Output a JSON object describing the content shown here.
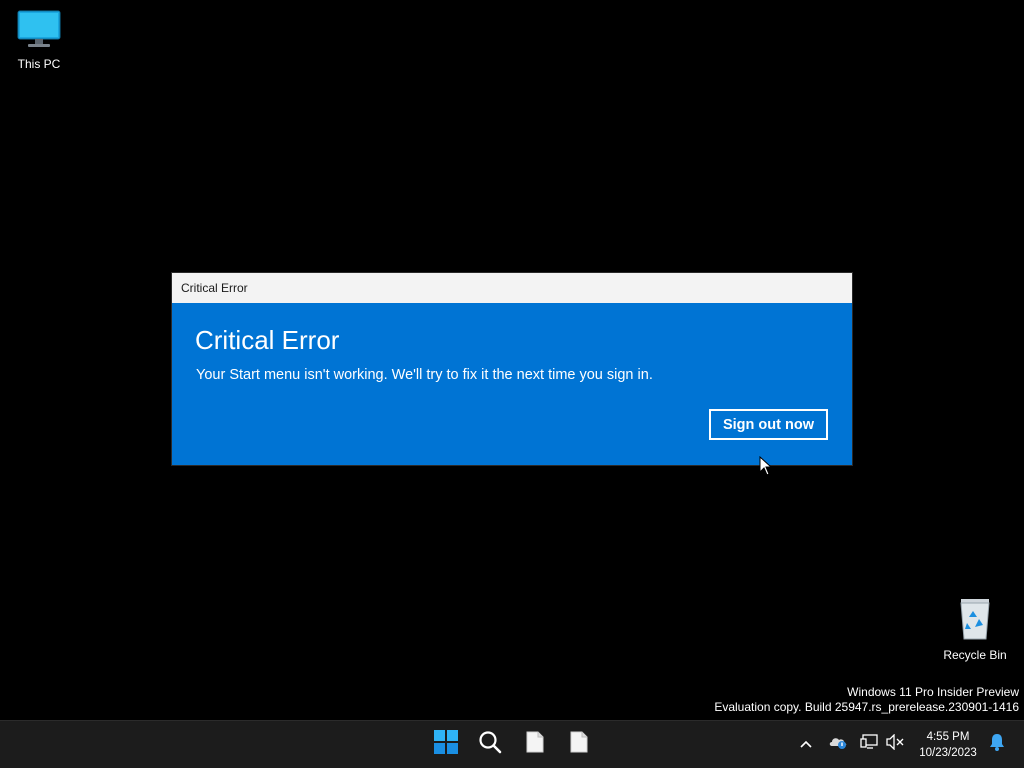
{
  "desktop": {
    "icons": [
      {
        "label": "This PC",
        "icon": "monitor-icon"
      },
      {
        "label": "Recycle Bin",
        "icon": "recycle-bin-icon"
      }
    ],
    "watermark": {
      "line1": "Windows 11 Pro Insider Preview",
      "line2": "Evaluation copy. Build 25947.rs_prerelease.230901-1416"
    }
  },
  "dialog": {
    "window_title": "Critical Error",
    "heading": "Critical Error",
    "message": "Your Start menu isn't working. We'll try to fix it the next time you sign in.",
    "button_label": "Sign out now",
    "accent_color": "#0074d4"
  },
  "taskbar": {
    "pinned": [
      {
        "name": "start",
        "icon": "windows-logo-icon"
      },
      {
        "name": "search",
        "icon": "search-icon"
      },
      {
        "name": "file",
        "icon": "document-icon"
      },
      {
        "name": "file",
        "icon": "document-icon"
      }
    ],
    "tray": {
      "icons": [
        "chevron-up-icon",
        "onedrive-icon",
        "network-icon",
        "volume-muted-icon",
        "bell-icon"
      ],
      "time": "4:55 PM",
      "date": "10/23/2023"
    }
  }
}
